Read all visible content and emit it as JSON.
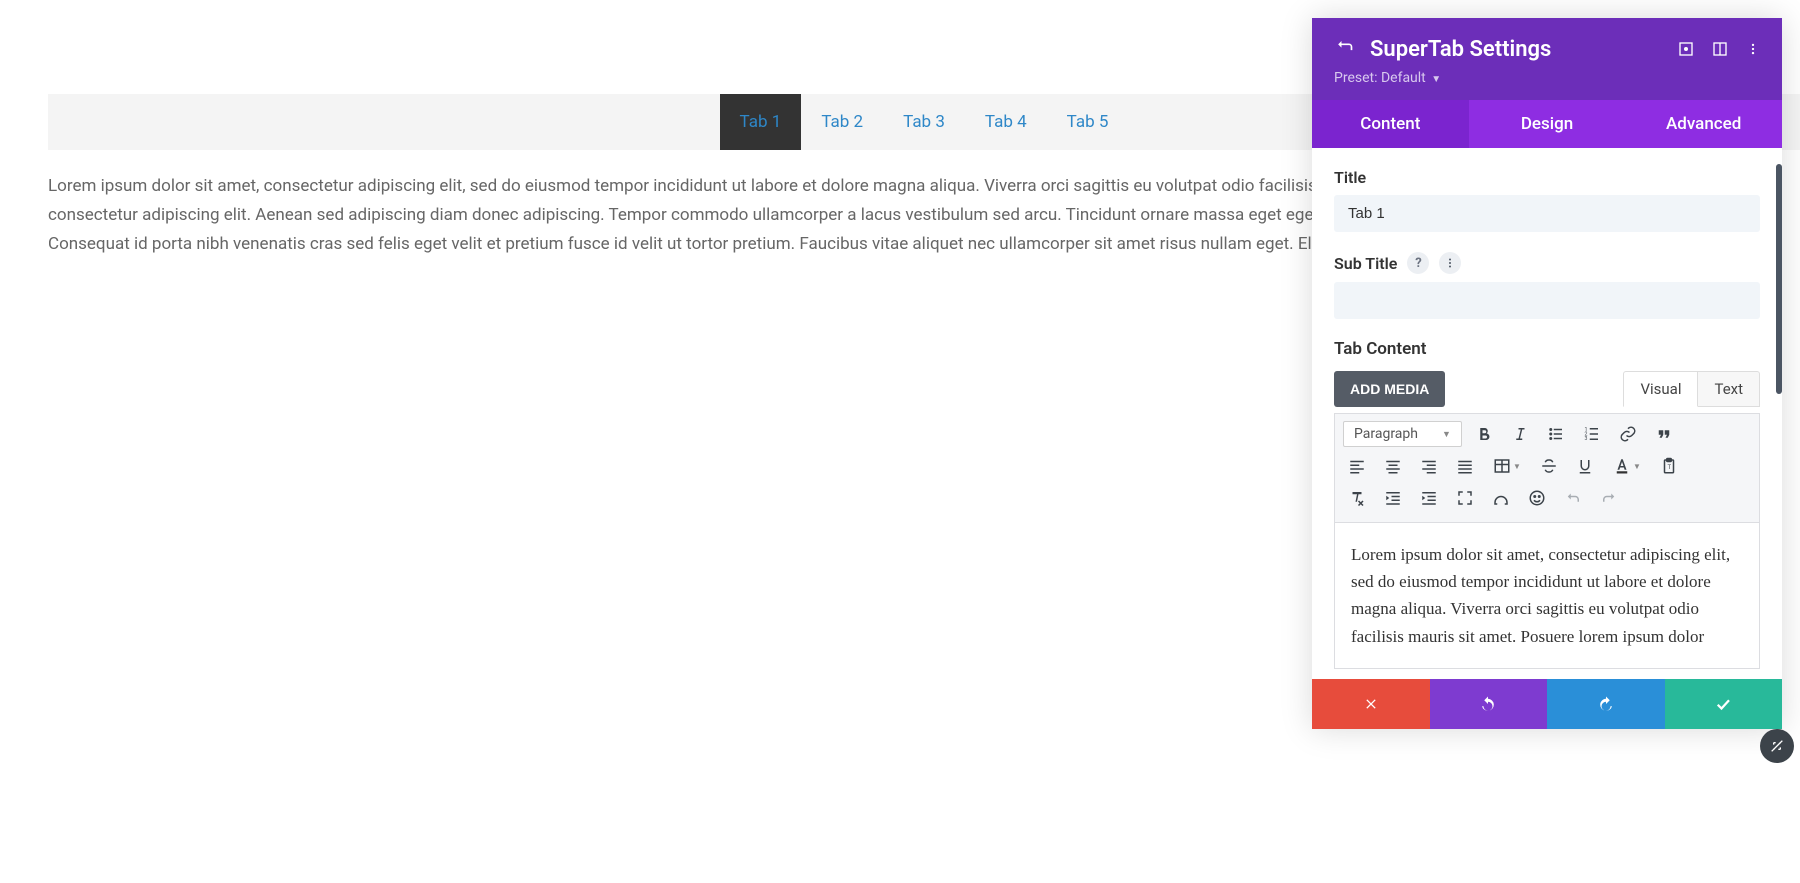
{
  "page": {
    "tabs": [
      {
        "label": "Tab 1",
        "active": true
      },
      {
        "label": "Tab 2"
      },
      {
        "label": "Tab 3"
      },
      {
        "label": "Tab 4"
      },
      {
        "label": "Tab 5"
      }
    ],
    "content_text": "Lorem ipsum dolor sit amet, consectetur adipiscing elit, sed do eiusmod tempor incididunt ut labore et dolore magna aliqua. Viverra orci sagittis eu volutpat odio facilisis mauris sit amet. Posuere lorem ipsum dolor sit amet consectetur adipiscing elit. Aenean sed adipiscing diam donec adipiscing. Tempor commodo ullamcorper a lacus vestibulum sed arcu. Tincidunt ornare massa eget egestas purus. In nibh mauris cursus mattis molestie a iaculis. Consequat id porta nibh venenatis cras sed felis eget velit et pretium fusce id velit ut tortor pretium. Faucibus vitae aliquet nec ullamcorper sit amet risus nullam eget. Eleifend mi in nulla posuere."
  },
  "panel": {
    "title": "SuperTab Settings",
    "preset_label": "Preset: Default",
    "tabs": {
      "content": "Content",
      "design": "Design",
      "advanced": "Advanced"
    },
    "fields": {
      "title_label": "Title",
      "title_value": "Tab 1",
      "subtitle_label": "Sub Title",
      "subtitle_value": "",
      "tab_content_label": "Tab Content"
    },
    "editor": {
      "add_media": "ADD MEDIA",
      "mode_visual": "Visual",
      "mode_text": "Text",
      "format_select": "Paragraph",
      "content": "Lorem ipsum dolor sit amet, consectetur adipiscing elit, sed do eiusmod tempor incididunt ut labore et dolore magna aliqua. Viverra orci sagittis eu volutpat odio facilisis mauris sit amet. Posuere lorem ipsum dolor"
    },
    "help_symbol": "?"
  }
}
